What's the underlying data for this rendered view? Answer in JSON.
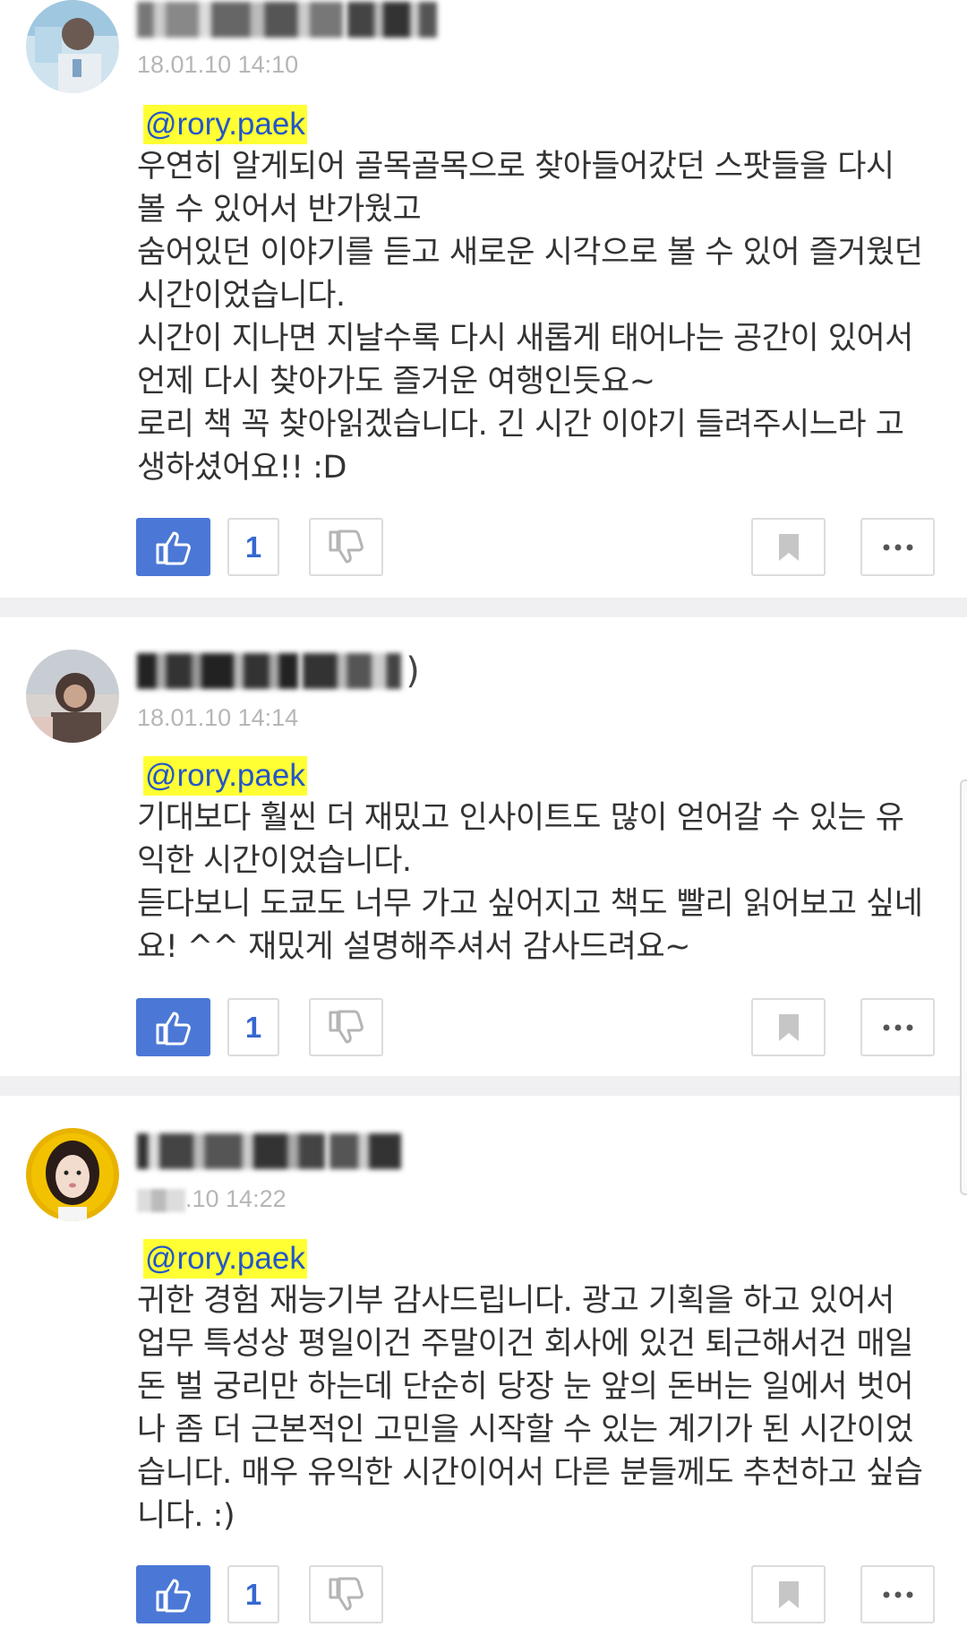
{
  "comments": [
    {
      "author": "",
      "date": "18.01.10 14:10",
      "mention": "@rory.paek",
      "text": "우연히 알게되어 골목골목으로 찾아들어갔던 스팟들을 다시\n볼 수 있어서 반가웠고\n숨어있던 이야기를 듣고 새로운 시각으로 볼 수 있어 즐거웠던\n 시간이었습니다.\n시간이 지나면 지날수록 다시 새롭게 태어나는 공간이 있어서\n언제 다시 찾아가도 즐거운 여행인듯요~\n로리 책 꼭 찾아읽겠습니다. 긴 시간 이야기 들려주시느라 고\n생하셨어요!! :D",
      "likes": "1"
    },
    {
      "author": "",
      "date": "18.01.10 14:14",
      "mention": "@rory.paek",
      "text": "기대보다 훨씬 더 재밌고  인사이트도 많이 얻어갈 수 있는 유\n익한 시간이었습니다.\n듣다보니 도쿄도 너무 가고 싶어지고 책도 빨리 읽어보고 싶네\n요! ^^ 재밌게 설명해주셔서 감사드려요~",
      "likes": "1"
    },
    {
      "author": "",
      "date": ".10 14:22",
      "mention": "@rory.paek",
      "text": "귀한 경험 재능기부 감사드립니다. 광고 기획을 하고 있어서\n업무 특성상 평일이건 주말이건 회사에 있건 퇴근해서건 매일\n돈 벌 궁리만 하는데 단순히 당장 눈 앞의 돈버는 일에서 벗어\n나 좀 더 근본적인 고민을 시작할 수 있는 계기가 된 시간이었\n습니다. 매우 유익한 시간이어서 다른 분들께도 추천하고 싶습\n니다. :)",
      "likes": "1"
    }
  ],
  "icons": {
    "like": "thumbs-up-icon",
    "dislike": "thumbs-down-icon",
    "bookmark": "bookmark-icon",
    "more": "more-icon"
  },
  "colors": {
    "accent": "#4b78d6",
    "mention_highlight": "#ffff33",
    "mention_text": "#2456c8",
    "separator": "#f0f0f2"
  }
}
